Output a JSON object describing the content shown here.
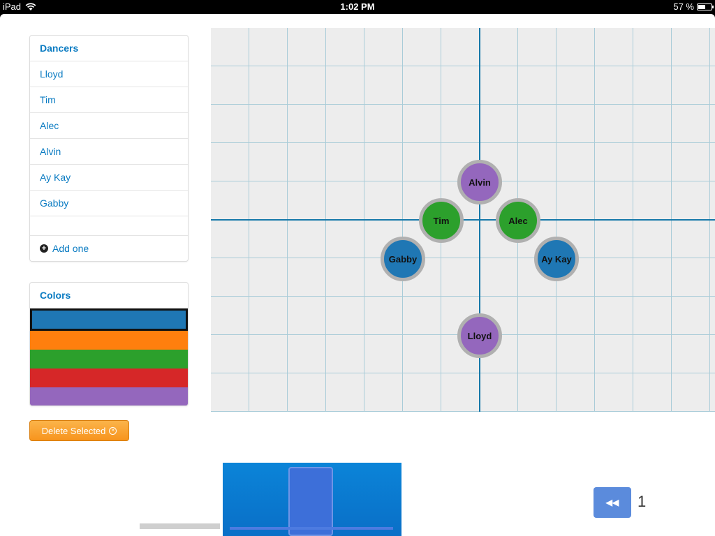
{
  "status_bar": {
    "device": "iPad",
    "time": "1:02 PM",
    "battery": "57 %",
    "battery_level": 0.57
  },
  "dancers_panel": {
    "title": "Dancers",
    "items": [
      "Lloyd",
      "Tim",
      "Alec",
      "Alvin",
      "Ay Kay",
      "Gabby"
    ],
    "add_label": "Add one"
  },
  "colors_panel": {
    "title": "Colors",
    "swatches": [
      "#1f77b4",
      "#ff7f0e",
      "#2ca02c",
      "#d62728",
      "#9467bd"
    ],
    "selected_index": 0
  },
  "delete_button": {
    "label": "Delete Selected"
  },
  "stage": {
    "dancers": [
      {
        "name": "Alvin",
        "color": "#9467bd"
      },
      {
        "name": "Tim",
        "color": "#2ca02c"
      },
      {
        "name": "Alec",
        "color": "#2ca02c"
      },
      {
        "name": "Gabby",
        "color": "#1f77b4"
      },
      {
        "name": "Ay Kay",
        "color": "#1f77b4"
      },
      {
        "name": "Lloyd",
        "color": "#9467bd"
      }
    ]
  },
  "playback": {
    "frame_number": "1"
  }
}
